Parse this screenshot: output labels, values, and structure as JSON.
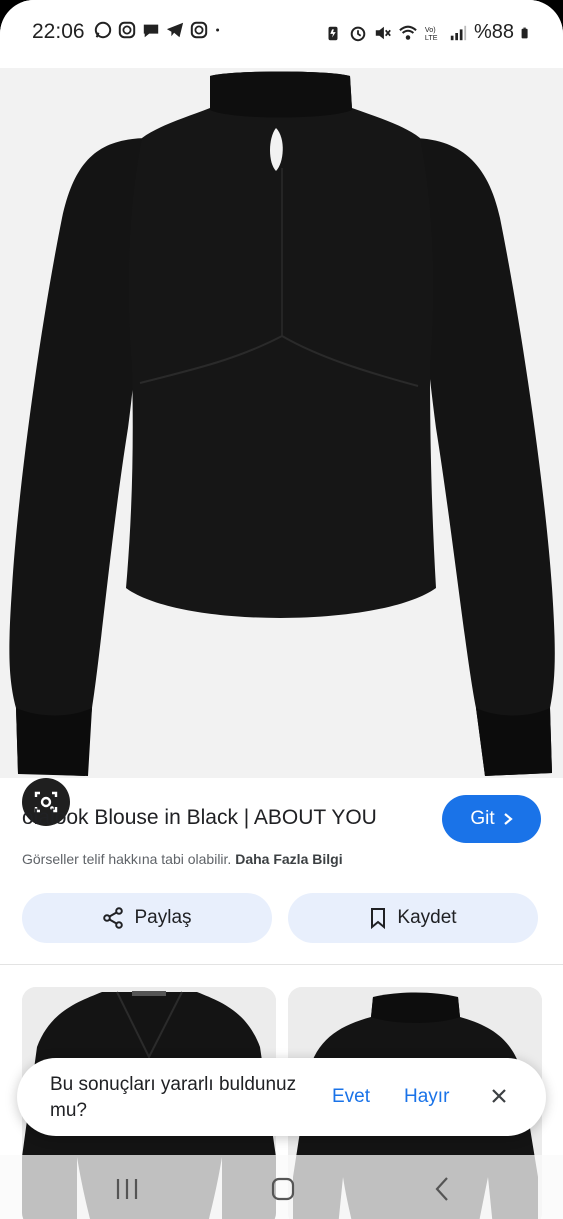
{
  "status_bar": {
    "time": "22:06",
    "left_icons": [
      "whatsapp-icon",
      "instagram-icon",
      "messages-icon",
      "telegram-icon",
      "instagram-icon",
      "dot-icon"
    ],
    "right_icons": [
      "battery-saver-icon",
      "alarm-icon",
      "mute-icon",
      "wifi-icon",
      "volte-icon",
      "signal-icon"
    ],
    "battery_text": "%88"
  },
  "result": {
    "title": "olalook Blouse in Black | ABOUT YOU",
    "visit_label": "Git",
    "copyright_text": "Görseller telif hakkına tabi olabilir.",
    "more_info_label": "Daha Fazla Bilgi",
    "share_label": "Paylaş",
    "save_label": "Kaydet"
  },
  "feedback": {
    "question": "Bu sonuçları yararlı buldunuz mu?",
    "yes_label": "Evet",
    "no_label": "Hayır"
  },
  "colors": {
    "accent": "#1a73e8",
    "pill_bg": "#e8effc",
    "garment": "#111111"
  }
}
